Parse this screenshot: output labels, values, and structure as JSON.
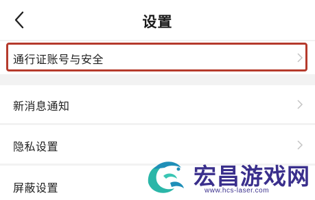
{
  "header": {
    "title": "设置",
    "back_icon": "chevron-left-icon"
  },
  "settings": {
    "items": [
      {
        "label": "通行证账号与安全",
        "icon": "chevron-right-icon",
        "highlighted": true
      },
      {
        "label": "新消息通知",
        "icon": "chevron-right-icon"
      },
      {
        "label": "隐私设置",
        "icon": "chevron-right-icon"
      },
      {
        "label": "屏蔽设置"
      }
    ]
  },
  "watermark": {
    "name": "宏昌游戏网",
    "url": "www.hcs-laser.com"
  },
  "colors": {
    "highlight_border": "#b53a2c",
    "watermark": "#3a2f8c",
    "background": "#f2f2f2"
  }
}
